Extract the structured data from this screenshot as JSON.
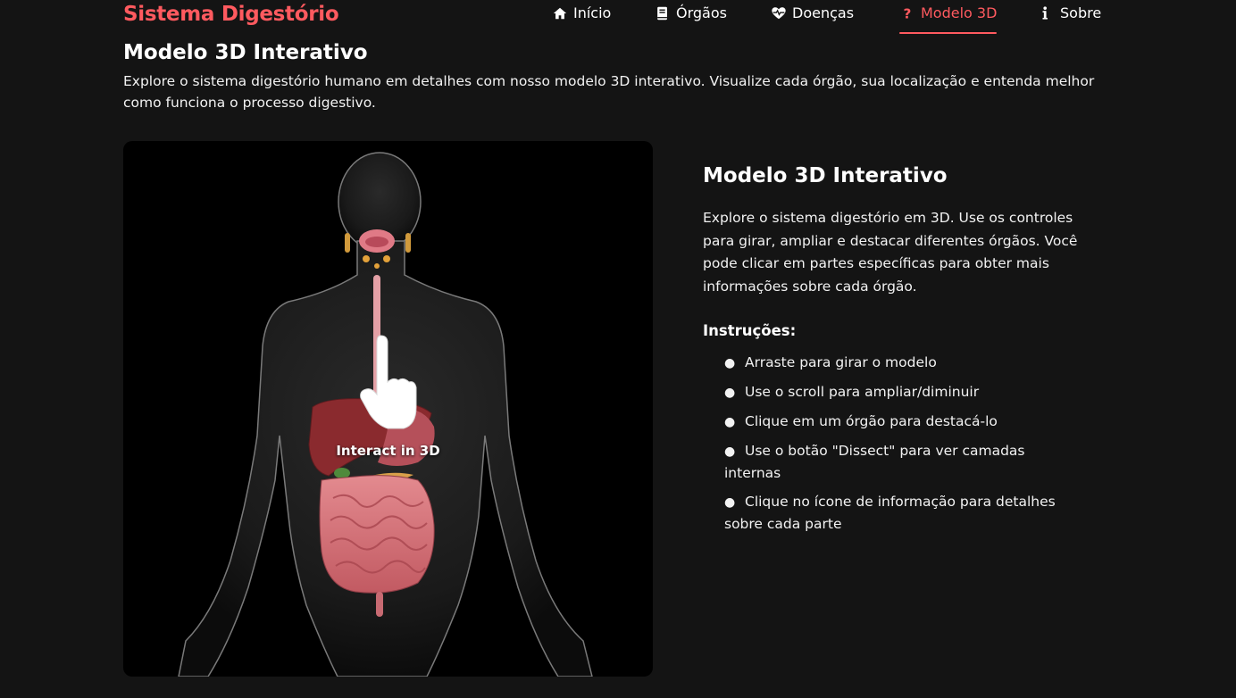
{
  "header": {
    "brand": "Sistema Digestório",
    "nav": [
      {
        "label": "Início",
        "icon": "home-icon",
        "active": false
      },
      {
        "label": "Órgãos",
        "icon": "book-icon",
        "active": false
      },
      {
        "label": "Doenças",
        "icon": "heart-pulse-icon",
        "active": false
      },
      {
        "label": "Modelo 3D",
        "icon": "question-icon",
        "active": true
      },
      {
        "label": "Sobre",
        "icon": "info-icon",
        "active": false
      }
    ]
  },
  "main": {
    "title": "Modelo 3D Interativo",
    "description": "Explore o sistema digestório humano em detalhes com nosso modelo 3D interativo. Visualize cada órgão, sua localização e entenda melhor como funciona o processo digestivo."
  },
  "viewer": {
    "overlay_label": "Interact in 3D",
    "hand-icon": "pointer-hand-icon"
  },
  "info": {
    "title": "Modelo 3D Interativo",
    "text": "Explore o sistema digestório em 3D. Use os controles para girar, ampliar e destacar diferentes órgãos. Você pode clicar em partes específicas para obter mais informações sobre cada órgão.",
    "instructions_title": "Instruções:",
    "instructions": [
      "Arraste para girar o modelo",
      "Use o scroll para ampliar/diminuir",
      "Clique em um órgão para destacá-lo",
      "Use o botão \"Dissect\" para ver camadas internas",
      "Clique no ícone de informação para detalhes sobre cada parte"
    ]
  },
  "colors": {
    "accent": "#ff5a5f",
    "background": "#141414",
    "viewer_bg": "#000000"
  }
}
